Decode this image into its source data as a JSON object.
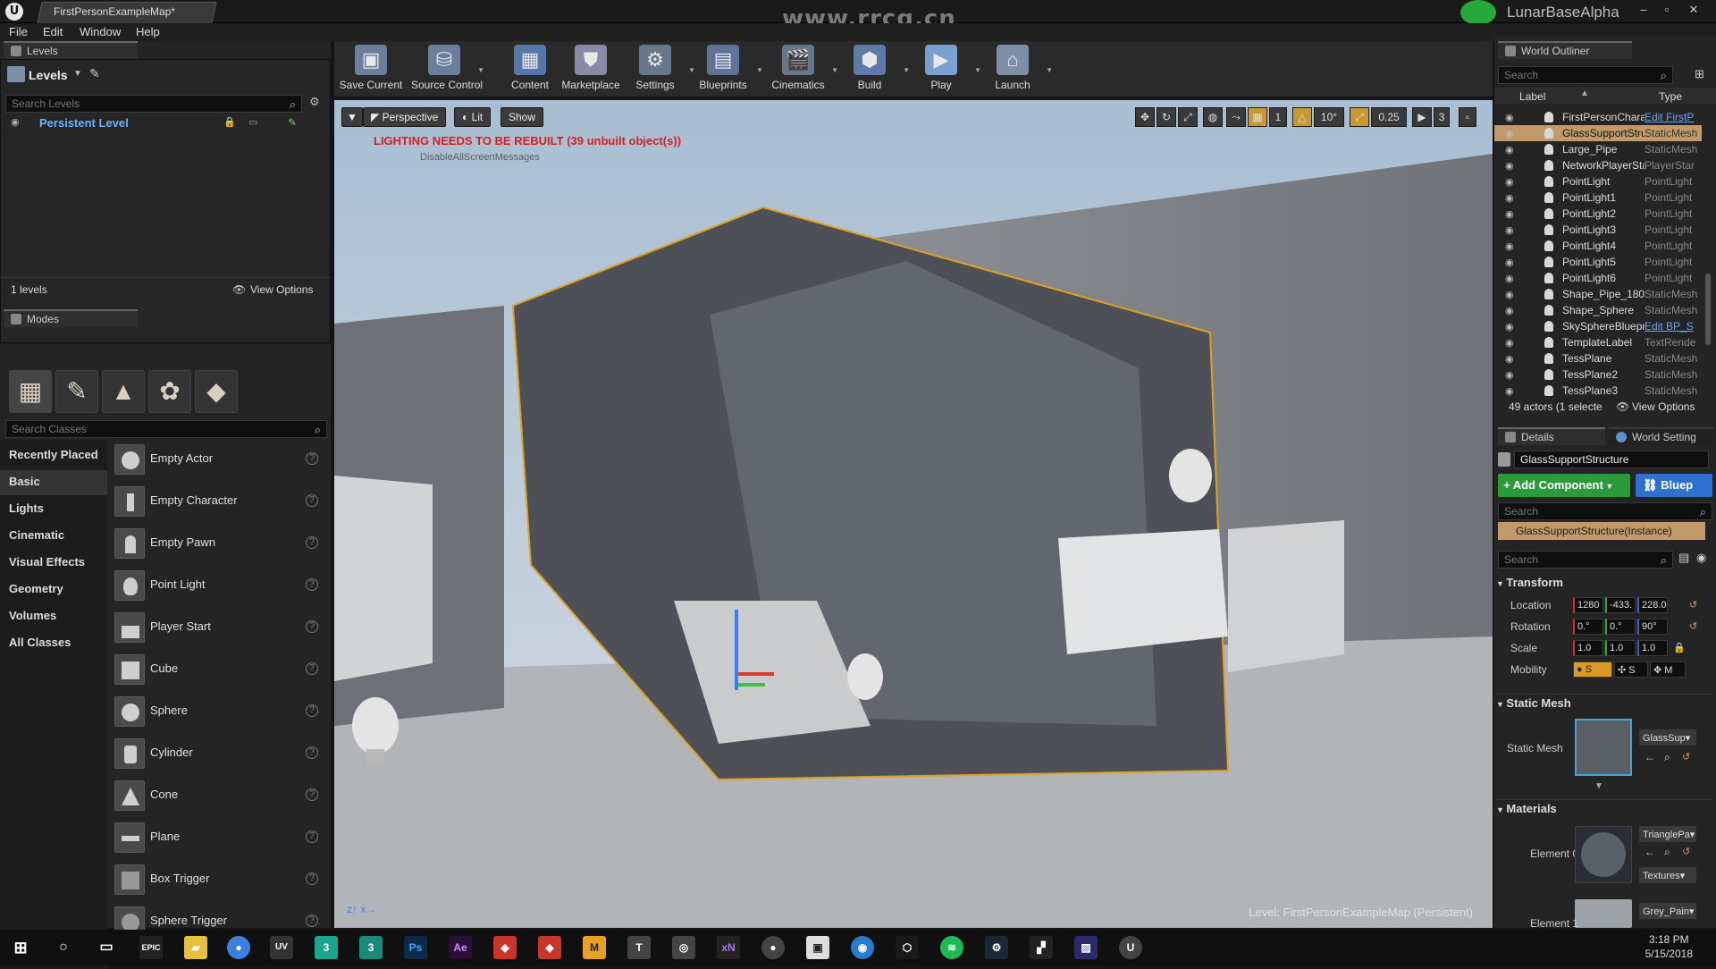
{
  "title_bar": {
    "document_tab": "FirstPersonExampleMap*",
    "watermark": "www.rrcg.cn",
    "project_name": "LunarBaseAlpha",
    "minimize": "–",
    "restore": "▫",
    "close": "✕"
  },
  "menu": [
    "File",
    "Edit",
    "Window",
    "Help"
  ],
  "levels_panel": {
    "tab": "Levels",
    "header": "Levels",
    "search_placeholder": "Search Levels",
    "persistent_level": "Persistent Level",
    "count": "1 levels",
    "view_options": "View Options"
  },
  "modes_panel": {
    "tab": "Modes",
    "search_placeholder": "Search Classes",
    "mode_icons": [
      "place-icon",
      "paint-icon",
      "landscape-icon",
      "foliage-icon",
      "geometry-edit-icon"
    ],
    "categories": [
      "Recently Placed",
      "Basic",
      "Lights",
      "Cinematic",
      "Visual Effects",
      "Geometry",
      "Volumes",
      "All Classes"
    ],
    "selected_category": "Basic",
    "items": [
      "Empty Actor",
      "Empty Character",
      "Empty Pawn",
      "Point Light",
      "Player Start",
      "Cube",
      "Sphere",
      "Cylinder",
      "Cone",
      "Plane",
      "Box Trigger",
      "Sphere Trigger"
    ]
  },
  "toolbar": {
    "buttons": [
      {
        "label": "Save Current",
        "icon": "save-icon"
      },
      {
        "label": "Source Control",
        "icon": "source-control-icon"
      },
      {
        "label": "Content",
        "icon": "content-icon"
      },
      {
        "label": "Marketplace",
        "icon": "marketplace-icon"
      },
      {
        "label": "Settings",
        "icon": "settings-icon"
      },
      {
        "label": "Blueprints",
        "icon": "blueprints-icon"
      },
      {
        "label": "Cinematics",
        "icon": "cinematics-icon"
      },
      {
        "label": "Build",
        "icon": "build-icon"
      },
      {
        "label": "Play",
        "icon": "play-icon"
      },
      {
        "label": "Launch",
        "icon": "launch-icon"
      }
    ]
  },
  "viewport": {
    "perspective": "Perspective",
    "lit": "Lit",
    "show": "Show",
    "warning": "LIGHTING NEEDS TO BE REBUILT (39 unbuilt object(s))",
    "sub_warning": "DisableAllScreenMessages",
    "grid_snap": "1",
    "rotation_snap": "10°",
    "scale_snap": "0.25",
    "camera_speed": "3",
    "level_label": "Level:  FirstPersonExampleMap (Persistent)"
  },
  "outliner": {
    "tab": "World Outliner",
    "search_placeholder": "Search",
    "col_label": "Label",
    "col_type": "Type",
    "rows": [
      {
        "name": "FirstPersonChara",
        "type": "Edit FirstP",
        "link": true,
        "selected": false
      },
      {
        "name": "GlassSupportStru",
        "type": "StaticMesh",
        "link": false,
        "selected": true
      },
      {
        "name": "Large_Pipe",
        "type": "StaticMesh",
        "link": false,
        "selected": false
      },
      {
        "name": "NetworkPlayerSta",
        "type": "PlayerStar",
        "link": false,
        "selected": false
      },
      {
        "name": "PointLight",
        "type": "PointLight",
        "link": false,
        "selected": false
      },
      {
        "name": "PointLight1",
        "type": "PointLight",
        "link": false,
        "selected": false
      },
      {
        "name": "PointLight2",
        "type": "PointLight",
        "link": false,
        "selected": false
      },
      {
        "name": "PointLight3",
        "type": "PointLight",
        "link": false,
        "selected": false
      },
      {
        "name": "PointLight4",
        "type": "PointLight",
        "link": false,
        "selected": false
      },
      {
        "name": "PointLight5",
        "type": "PointLight",
        "link": false,
        "selected": false
      },
      {
        "name": "PointLight6",
        "type": "PointLight",
        "link": false,
        "selected": false
      },
      {
        "name": "Shape_Pipe_180",
        "type": "StaticMesh",
        "link": false,
        "selected": false
      },
      {
        "name": "Shape_Sphere",
        "type": "StaticMesh",
        "link": false,
        "selected": false
      },
      {
        "name": "SkySphereBluepr",
        "type": "Edit BP_S",
        "link": true,
        "selected": false
      },
      {
        "name": "TemplateLabel",
        "type": "TextRende",
        "link": false,
        "selected": false
      },
      {
        "name": "TessPlane",
        "type": "StaticMesh",
        "link": false,
        "selected": false
      },
      {
        "name": "TessPlane2",
        "type": "StaticMesh",
        "link": false,
        "selected": false
      },
      {
        "name": "TessPlane3",
        "type": "StaticMesh",
        "link": false,
        "selected": false
      }
    ],
    "footer": "49 actors (1 selecte",
    "view_options": "View Options"
  },
  "details": {
    "tab": "Details",
    "tab2": "World Setting",
    "actor_name": "GlassSupportStructure",
    "add_component": "+ Add Component",
    "blueprint": "Bluep",
    "search_placeholder": "Search",
    "instance": "GlassSupportStructure(Instance)",
    "search2_placeholder": "Search",
    "transform_header": "Transform",
    "location_label": "Location",
    "location": [
      "1280",
      "-433.",
      "228.0"
    ],
    "rotation_label": "Rotation",
    "rotation": [
      "0.°",
      "0.°",
      "90°"
    ],
    "scale_label": "Scale",
    "scale": [
      "1.0",
      "1.0",
      "1.0"
    ],
    "mobility_label": "Mobility",
    "mobility": [
      "S",
      "S",
      "M"
    ],
    "static_mesh_header": "Static Mesh",
    "static_mesh_label": "Static Mesh",
    "static_mesh_value": "GlassSup",
    "materials_header": "Materials",
    "element0_label": "Element 0",
    "element0_value": "TrianglePa",
    "element0_textures": "Textures",
    "element1_label": "Element 1",
    "element1_value": "Grey_Pain"
  },
  "taskbar": {
    "apps": [
      "EPIC",
      "UV",
      "3",
      "3",
      "Ps",
      "Ae",
      "M",
      "xN"
    ],
    "time": "3:18 PM",
    "date": "5/15/2018"
  }
}
